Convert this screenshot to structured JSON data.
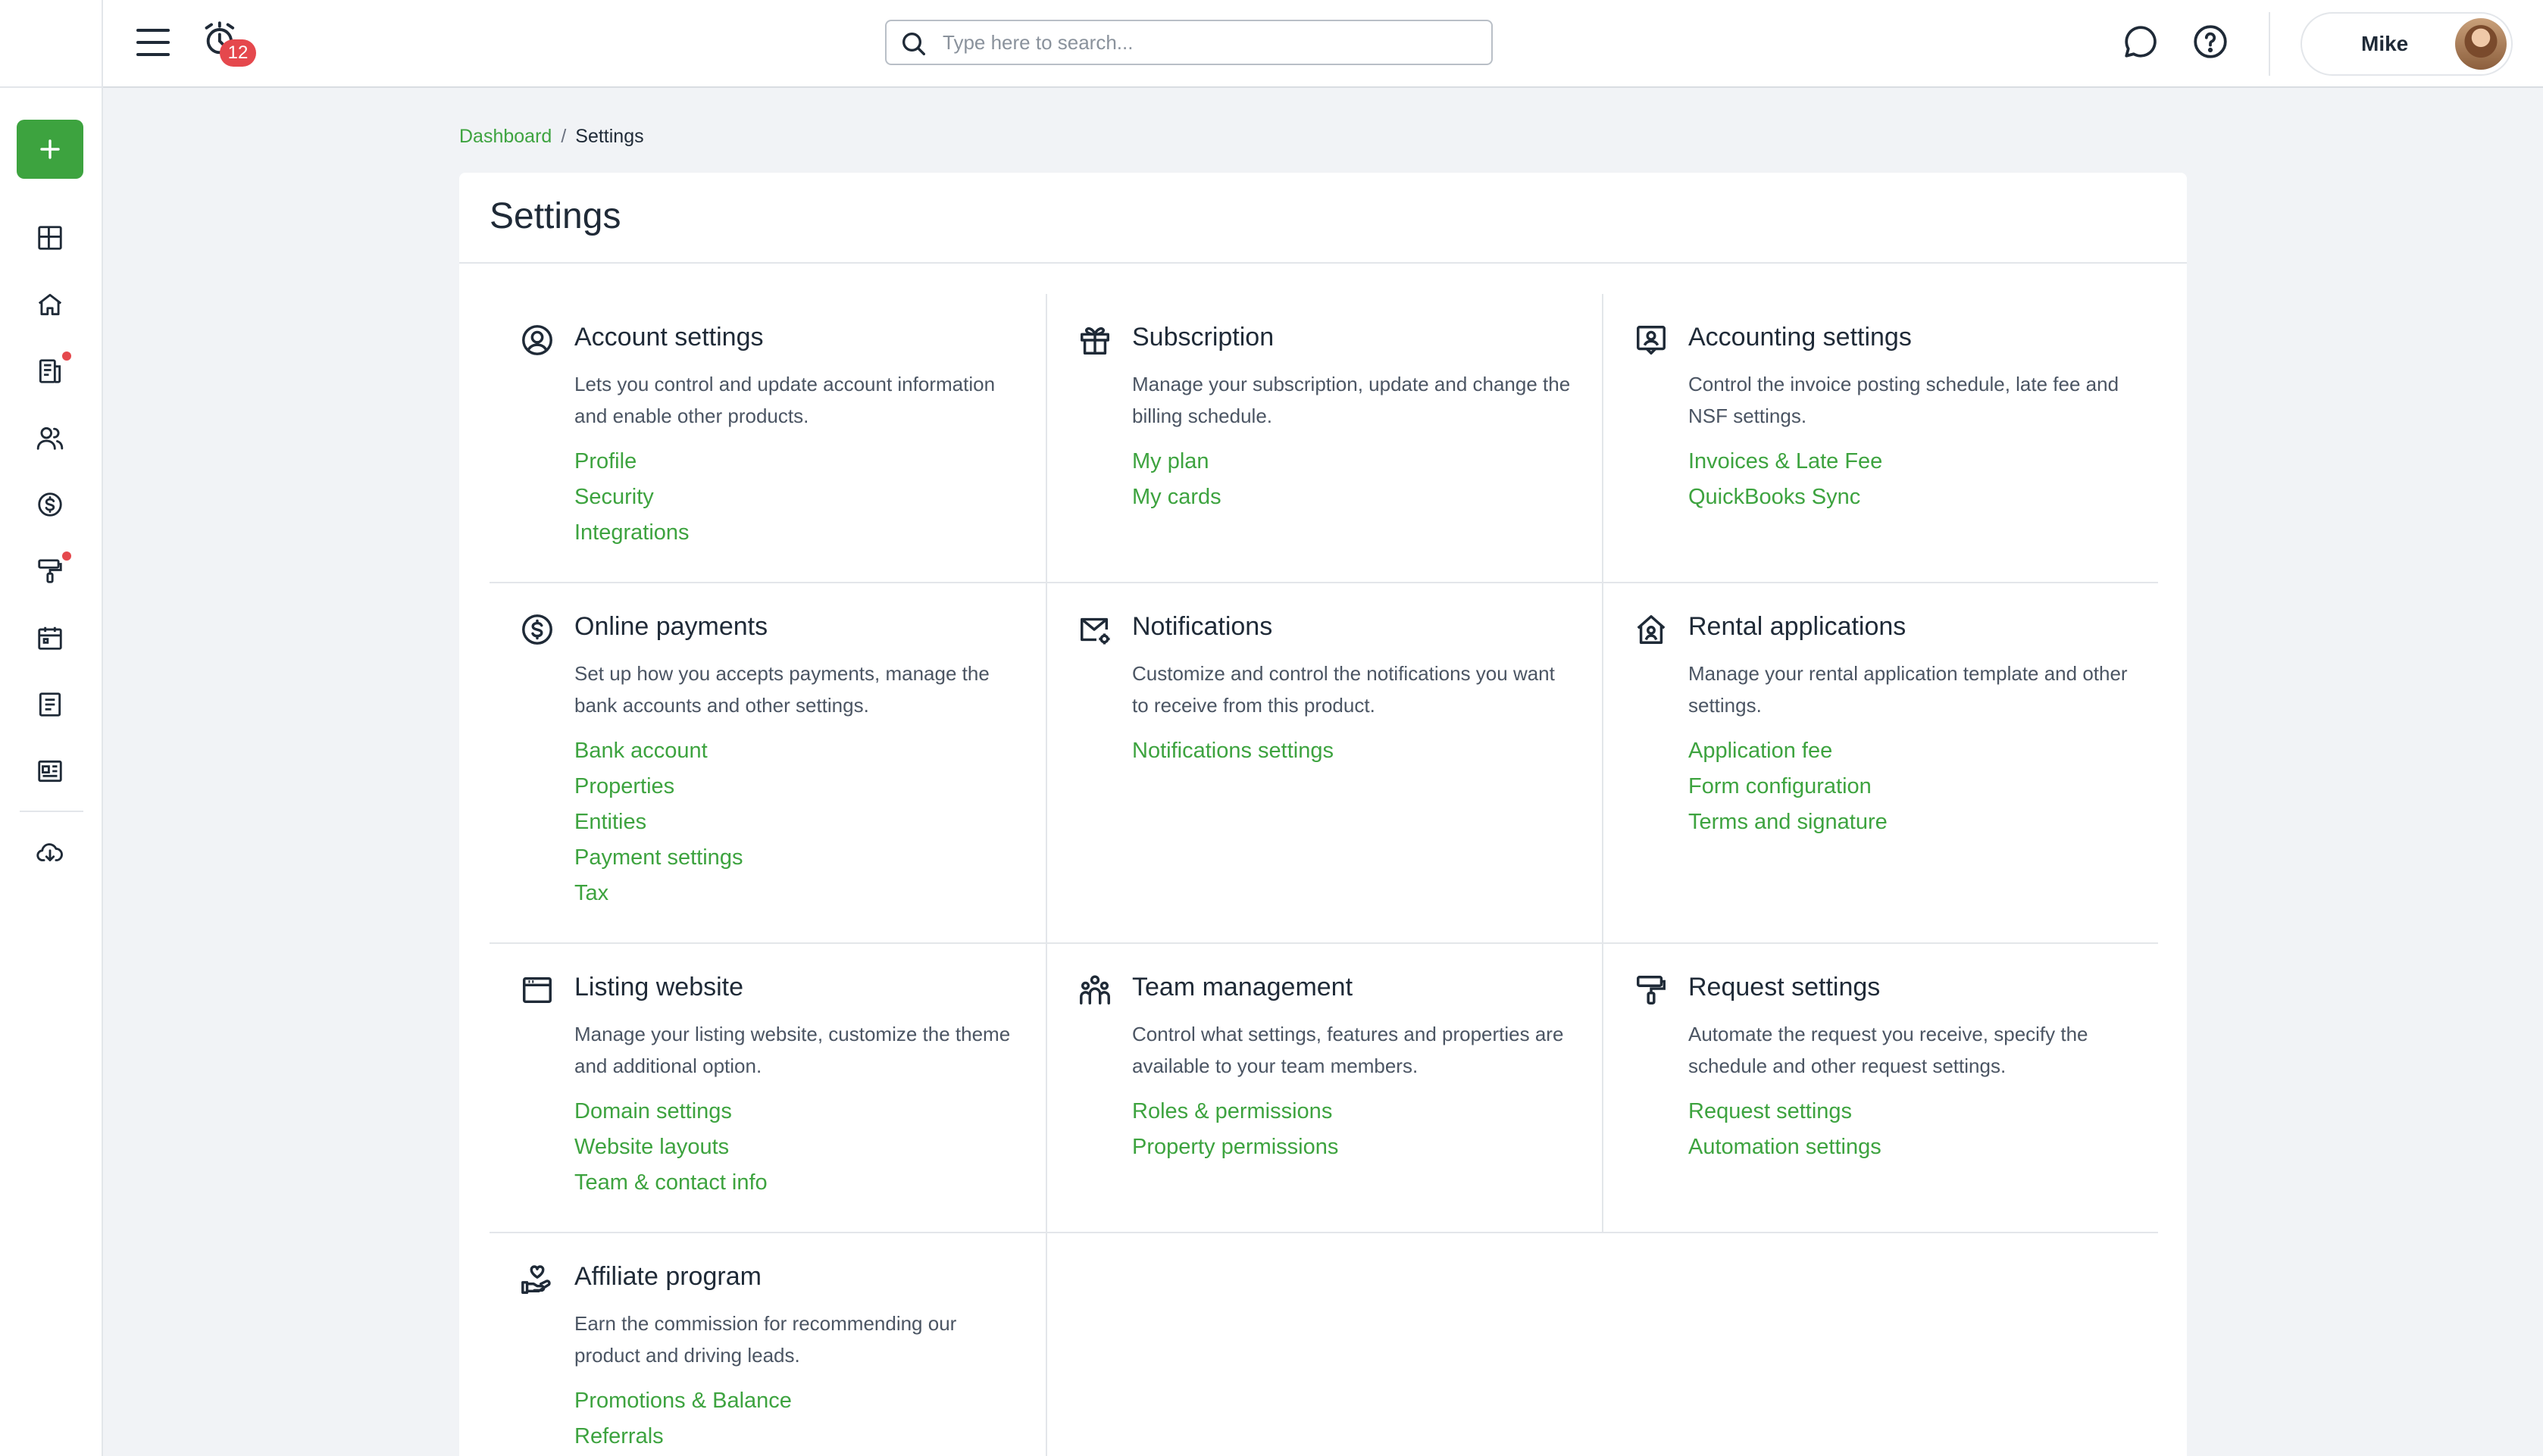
{
  "header": {
    "notification_count": "12",
    "search_placeholder": "Type here to search...",
    "user_name": "Mike"
  },
  "breadcrumb": {
    "parent": "Dashboard",
    "separator": "/",
    "current": "Settings"
  },
  "page": {
    "title": "Settings"
  },
  "sidebar": {
    "icons": [
      "add-icon",
      "dashboard-icon",
      "home-icon",
      "leases-icon",
      "people-icon",
      "payments-icon",
      "maintenance-icon",
      "calendar-icon",
      "reports-icon",
      "listings-icon",
      "download-icon"
    ]
  },
  "sections": {
    "account": {
      "title": "Account settings",
      "desc": "Lets you control and update account information and enable other products.",
      "links": [
        "Profile",
        "Security",
        "Integrations"
      ]
    },
    "subscription": {
      "title": "Subscription",
      "desc": "Manage your subscription, update and change the billing schedule.",
      "links": [
        "My plan",
        "My cards"
      ]
    },
    "accounting": {
      "title": "Accounting settings",
      "desc": "Control the invoice posting schedule, late fee and NSF settings.",
      "links": [
        "Invoices & Late Fee",
        "QuickBooks Sync"
      ]
    },
    "payments": {
      "title": "Online payments",
      "desc": "Set up how you accepts payments, manage the bank accounts and other settings.",
      "links": [
        "Bank account",
        "Properties",
        "Entities",
        "Payment settings",
        "Tax"
      ]
    },
    "notifications": {
      "title": "Notifications",
      "desc": "Customize and control the notifications you want to receive from this product.",
      "links": [
        "Notifications settings"
      ]
    },
    "rental": {
      "title": "Rental applications",
      "desc": "Manage your rental application template and other settings.",
      "links": [
        "Application fee",
        "Form configuration",
        "Terms and signature"
      ]
    },
    "listing": {
      "title": "Listing website",
      "desc": "Manage your listing website, customize the theme and additional option.",
      "links": [
        "Domain settings",
        "Website layouts",
        "Team & contact info"
      ]
    },
    "team": {
      "title": "Team management",
      "desc": "Control what settings, features and properties are available to your team members.",
      "links": [
        "Roles & permissions",
        "Property permissions"
      ]
    },
    "request": {
      "title": "Request settings",
      "desc": "Automate the request you receive, specify the schedule and other request settings.",
      "links": [
        "Request settings",
        "Automation settings"
      ]
    },
    "affiliate": {
      "title": "Affiliate program",
      "desc": "Earn the commission for recommending our product and driving leads.",
      "links": [
        "Promotions & Balance",
        "Referrals"
      ]
    }
  },
  "colors": {
    "accent": "#3da33f",
    "badge": "#e5484d",
    "text": "#1f2a37",
    "muted": "#4b5563"
  }
}
